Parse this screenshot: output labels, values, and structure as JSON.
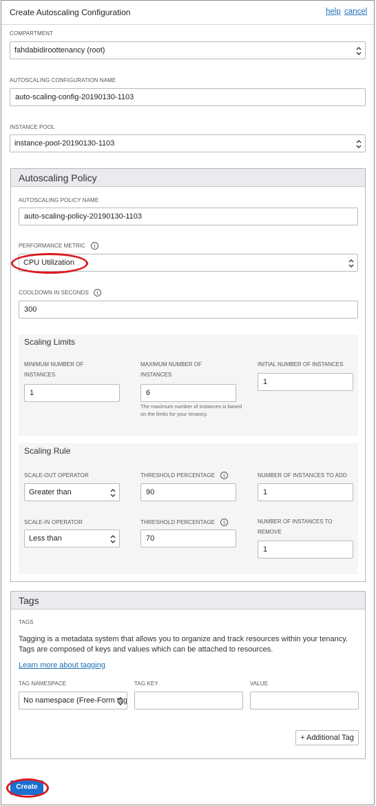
{
  "header": {
    "title": "Create Autoscaling Configuration",
    "help_label": "help",
    "cancel_label": "cancel"
  },
  "compartment": {
    "label": "COMPARTMENT",
    "value": "fahdabidiroottenancy (root)"
  },
  "config_name": {
    "label": "AUTOSCALING CONFIGURATION NAME",
    "value": "auto-scaling-config-20190130-1103"
  },
  "instance_pool": {
    "label": "INSTANCE POOL",
    "value": "instance-pool-20190130-1103"
  },
  "policy": {
    "title": "Autoscaling Policy",
    "name_label": "AUTOSCALING POLICY NAME",
    "name_value": "auto-scaling-policy-20190130-1103",
    "metric_label": "PERFORMANCE METRIC",
    "metric_value": "CPU Utilization",
    "cooldown_label": "COOLDOWN IN SECONDS",
    "cooldown_value": "300"
  },
  "limits": {
    "title": "Scaling Limits",
    "min_label": "MINIMUM NUMBER OF INSTANCES",
    "min_value": "1",
    "max_label": "MAXIMUM NUMBER OF INSTANCES",
    "max_value": "6",
    "max_help": "The maximum number of instances is based on the limits for your tenancy.",
    "initial_label": "INITIAL NUMBER OF INSTANCES",
    "initial_value": "1"
  },
  "rule": {
    "title": "Scaling Rule",
    "scale_out_label": "SCALE-OUT OPERATOR",
    "scale_out_value": "Greater than",
    "threshold_out_label": "THRESHOLD PERCENTAGE",
    "threshold_out_value": "90",
    "add_label": "NUMBER OF INSTANCES TO ADD",
    "add_value": "1",
    "scale_in_label": "SCALE-IN OPERATOR",
    "scale_in_value": "Less than",
    "threshold_in_label": "THRESHOLD PERCENTAGE",
    "threshold_in_value": "70",
    "remove_label": "NUMBER OF INSTANCES TO REMOVE",
    "remove_value": "1"
  },
  "tags": {
    "title": "Tags",
    "label": "TAGS",
    "description": "Tagging is a metadata system that allows you to organize and track resources within your tenancy. Tags are composed of keys and values which can be attached to resources.",
    "learn_more": "Learn more about tagging",
    "namespace_label": "TAG NAMESPACE",
    "namespace_value": "No namespace (Free-Form tags)",
    "key_label": "TAG KEY",
    "key_value": "",
    "value_label": "VALUE",
    "value_value": "",
    "add_tag_label": "+ Additional Tag"
  },
  "footer": {
    "create_label": "Create"
  },
  "icons": {
    "info": "info-icon",
    "chevron": "up-down-chevron-icon"
  },
  "colors": {
    "accent": "#1a6fcf",
    "link": "#1a6fb5",
    "highlight": "#d91a20"
  }
}
